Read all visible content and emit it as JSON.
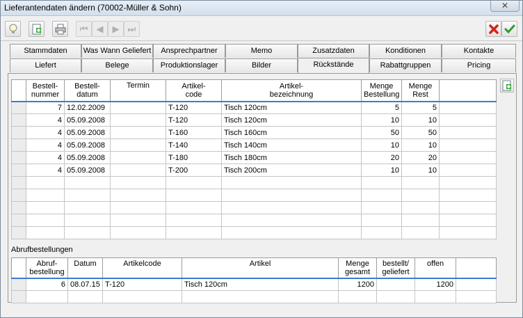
{
  "window": {
    "title": "Lieferantendaten ändern (70002-Müller & Sohn)",
    "close_glyph": "✕"
  },
  "toolbar": {
    "icons": [
      "lightbulb-icon",
      "add-document-icon",
      "print-icon",
      "first-icon",
      "prev-icon",
      "next-icon",
      "last-icon",
      "cancel-icon",
      "ok-icon"
    ]
  },
  "tabs_row1": [
    "Stammdaten",
    "Was Wann Geliefert",
    "Ansprechpartner",
    "Memo",
    "Zusatzdaten",
    "Konditionen",
    "Kontakte"
  ],
  "tabs_row2": [
    "Liefert",
    "Belege",
    "Produktionslager",
    "Bilder",
    "Rückstände",
    "Rabattgruppen",
    "Pricing"
  ],
  "orders": {
    "headers": [
      "Bestell-\nnummer",
      "Bestell-\ndatum",
      "Termin",
      "Artikel-\ncode",
      "Artikel-\nbezeichnung",
      "Menge\nBestellung",
      "Menge\nRest"
    ],
    "rows": [
      [
        "7",
        "12.02.2009",
        "",
        "T-120",
        "Tisch 120cm",
        "5",
        "5"
      ],
      [
        "4",
        "05.09.2008",
        "",
        "T-120",
        "Tisch 120cm",
        "10",
        "10"
      ],
      [
        "4",
        "05.09.2008",
        "",
        "T-160",
        "Tisch 160cm",
        "50",
        "50"
      ],
      [
        "4",
        "05.09.2008",
        "",
        "T-140",
        "Tisch 140cm",
        "10",
        "10"
      ],
      [
        "4",
        "05.09.2008",
        "",
        "T-180",
        "Tisch 180cm",
        "20",
        "20"
      ],
      [
        "4",
        "05.09.2008",
        "",
        "T-200",
        "Tisch 200cm",
        "10",
        "10"
      ]
    ]
  },
  "abruf": {
    "label": "Abrufbestellungen",
    "headers": [
      "Abruf-\nbestellung",
      "Datum",
      "Artikelcode",
      "Artikel",
      "Menge\ngesamt",
      "bestellt/\ngeliefert",
      "offen"
    ],
    "rows": [
      [
        "6",
        "08.07.15",
        "T-120",
        "Tisch 120cm",
        "1200",
        "",
        "1200"
      ]
    ]
  }
}
